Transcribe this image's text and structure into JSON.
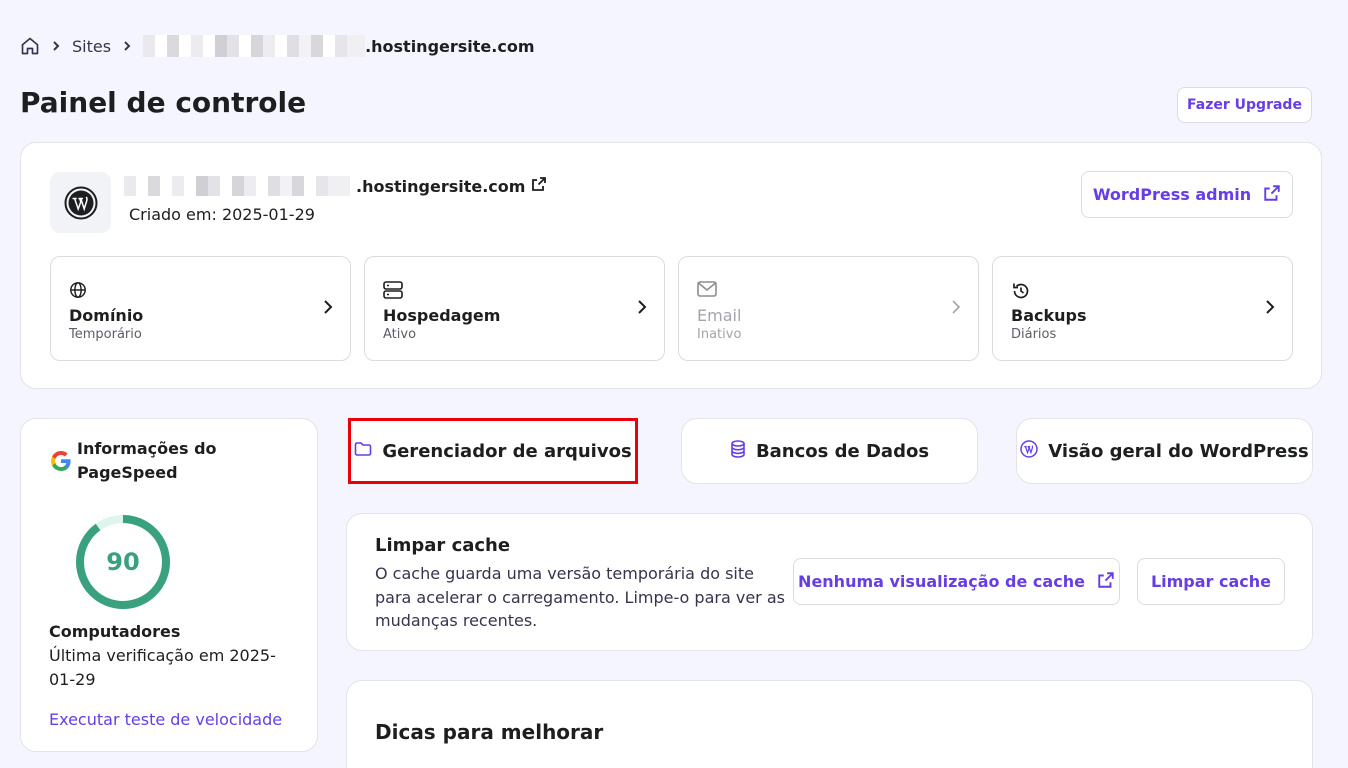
{
  "breadcrumb": {
    "sites_label": "Sites",
    "domain_suffix": ".hostingersite.com"
  },
  "page": {
    "title": "Painel de controle",
    "upgrade_label": "Fazer Upgrade"
  },
  "site": {
    "domain_suffix": ".hostingersite.com",
    "created_label": "Criado em: 2025-01-29",
    "wp_admin_label": "WordPress admin"
  },
  "tiles": [
    {
      "name": "Domínio",
      "status": "Temporário",
      "icon": "globe-icon",
      "enabled": true
    },
    {
      "name": "Hospedagem",
      "status": "Ativo",
      "icon": "server-icon",
      "enabled": true
    },
    {
      "name": "Email",
      "status": "Inativo",
      "icon": "mail-icon",
      "enabled": false
    },
    {
      "name": "Backups",
      "status": "Diários",
      "icon": "history-icon",
      "enabled": true
    }
  ],
  "pagespeed": {
    "title": "Informações do PageSpeed",
    "score": "90",
    "score_fraction": 0.9,
    "device": "Computadores",
    "last_check": "Última verificação em 2025-01-29",
    "run_test_label": "Executar teste de velocidade"
  },
  "quick_links": {
    "files": "Gerenciador de arquivos",
    "databases": "Bancos de Dados",
    "wp_overview": "Visão geral do WordPress"
  },
  "cache": {
    "title": "Limpar cache",
    "description": "O cache guarda uma versão temporária do site para acelerar o carregamento. Limpe-o para ver as mudanças recentes.",
    "preview_label": "Nenhuma visualização de cache",
    "clear_label": "Limpar cache"
  },
  "tips": {
    "title": "Dicas para melhorar"
  },
  "colors": {
    "accent": "#673de6",
    "gauge": "#3aa17e",
    "highlight": "#e8000b"
  }
}
